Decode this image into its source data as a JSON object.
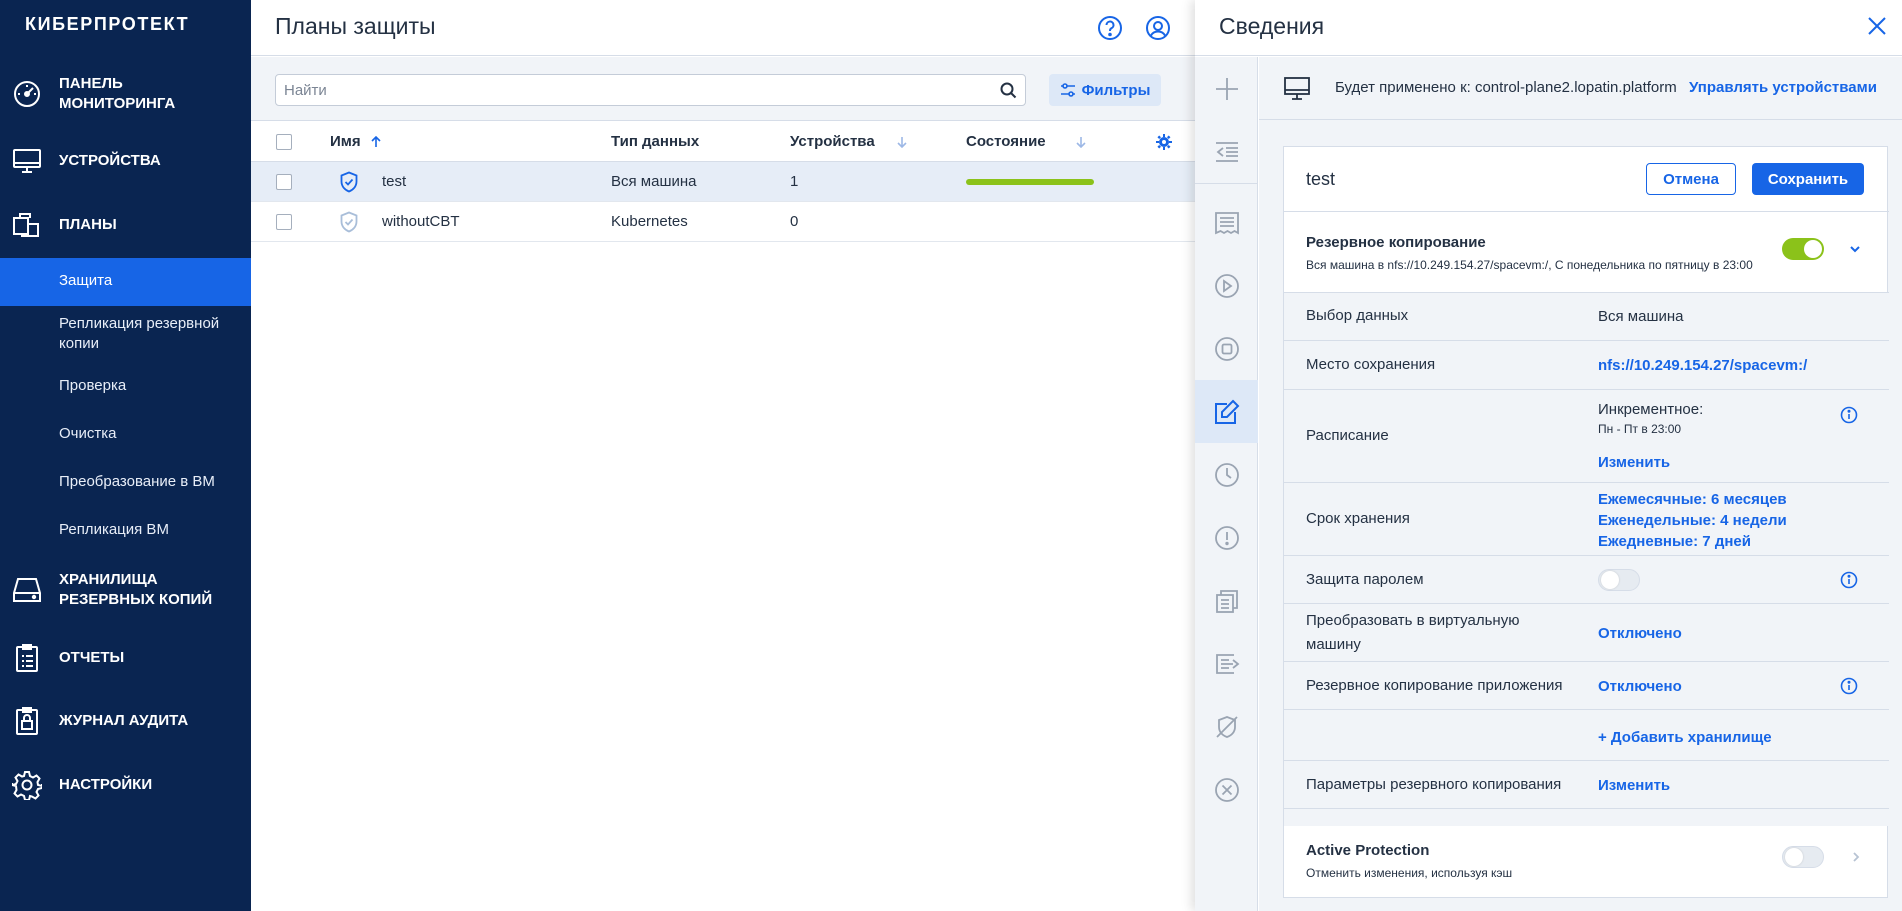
{
  "sidebar": {
    "logo": "КИБЕРПРОТЕКТ",
    "items": [
      {
        "label": "ПАНЕЛЬ\nМОНИТОРИНГА",
        "icon": "dashboard-icon"
      },
      {
        "label": "УСТРОЙСТВА",
        "icon": "monitor-icon"
      },
      {
        "label": "ПЛАНЫ",
        "icon": "plans-icon"
      },
      {
        "label": "ХРАНИЛИЩА\nРЕЗЕРВНЫХ КОПИЙ",
        "icon": "storage-icon"
      },
      {
        "label": "ОТЧЕТЫ",
        "icon": "reports-icon"
      },
      {
        "label": "ЖУРНАЛ АУДИТА",
        "icon": "audit-icon"
      },
      {
        "label": "НАСТРОЙКИ",
        "icon": "gear-icon"
      }
    ],
    "subitems": [
      {
        "label": "Защита",
        "active": true
      },
      {
        "label": "Репликация резервной\nкопии"
      },
      {
        "label": "Проверка"
      },
      {
        "label": "Очистка"
      },
      {
        "label": "Преобразование в ВМ"
      },
      {
        "label": "Репликация ВМ"
      }
    ]
  },
  "main": {
    "title": "Планы защиты",
    "search_placeholder": "Найти",
    "filters_label": "Фильтры",
    "columns": {
      "name": "Имя",
      "data_type": "Тип данных",
      "devices": "Устройства",
      "status": "Состояние"
    },
    "rows": [
      {
        "name": "test",
        "data_type": "Вся машина",
        "devices": "1",
        "status": "ok",
        "selected": true
      },
      {
        "name": "withoutCBT",
        "data_type": "Kubernetes",
        "devices": "0",
        "status": "",
        "selected": false
      }
    ]
  },
  "details": {
    "title": "Сведения",
    "applied_to": "Будет применено к: control-plane2.lopatin.platform",
    "manage_devices": "Управлять устройствами",
    "plan_name": "test",
    "cancel_label": "Отмена",
    "save_label": "Сохранить",
    "backup": {
      "title": "Резервное копирование",
      "subtitle": "Вся машина в nfs://10.249.154.27/spacevm:/, С понедельника по пятницу в 23:00",
      "enabled": true
    },
    "rows": {
      "data_selection_label": "Выбор данных",
      "data_selection_value": "Вся машина",
      "destination_label": "Место сохранения",
      "destination_value": "nfs://10.249.154.27/spacevm:/",
      "schedule_label": "Расписание",
      "schedule_type": "Инкрементное:",
      "schedule_time": "Пн - Пт в 23:00",
      "schedule_change": "Изменить",
      "retention_label": "Срок хранения",
      "retention_monthly": "Ежемесячные: 6 месяцев",
      "retention_weekly": "Еженедельные: 4 недели",
      "retention_daily": "Ежедневные: 7 дней",
      "password_label": "Защита паролем",
      "password_enabled": false,
      "convert_label": "Преобразовать в виртуальную\nмашину",
      "convert_value": "Отключено",
      "app_backup_label": "Резервное копирование приложения",
      "app_backup_value": "Отключено",
      "add_storage": "+ Добавить хранилище",
      "backup_params_label": "Параметры резервного копирования",
      "backup_params_change": "Изменить"
    },
    "active_protection": {
      "title": "Active Protection",
      "subtitle": "Отменить изменения, используя кэш",
      "enabled": false
    }
  },
  "colors": {
    "sidebar_bg": "#0a2551",
    "accent": "#1765e6",
    "status_ok": "#8bc21a"
  }
}
